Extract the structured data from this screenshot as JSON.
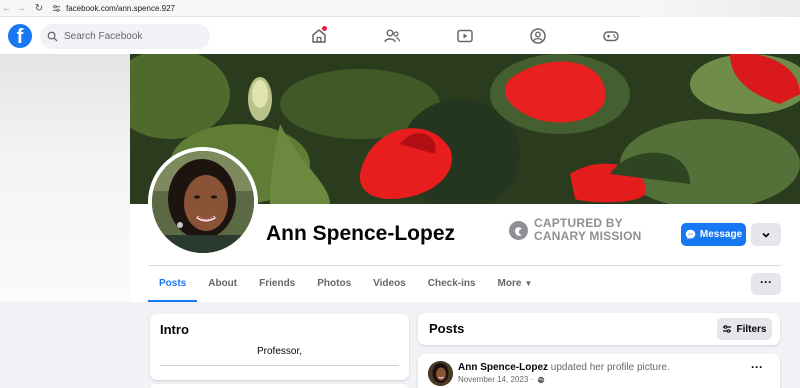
{
  "browser": {
    "url": "facebook.com/ann.spence.927",
    "back_icon": "arrow-left-icon",
    "forward_icon": "arrow-right-icon",
    "reload_icon": "reload-icon"
  },
  "nav": {
    "logo_letter": "f",
    "search_placeholder": "Search Facebook",
    "icons": [
      "home-icon",
      "friends-icon",
      "watch-icon",
      "groups-icon",
      "gaming-icon"
    ],
    "accent_color": "#1877f2",
    "notification_color": "#e41e3f"
  },
  "profile": {
    "name": "Ann Spence-Lopez",
    "stamp_line1": "CAPTURED BY",
    "stamp_line2": "CANARY MISSION",
    "message_label": "Message"
  },
  "tabs": [
    {
      "label": "Posts",
      "active": true
    },
    {
      "label": "About",
      "active": false
    },
    {
      "label": "Friends",
      "active": false
    },
    {
      "label": "Photos",
      "active": false
    },
    {
      "label": "Videos",
      "active": false
    },
    {
      "label": "Check-ins",
      "active": false
    },
    {
      "label": "More",
      "active": false
    }
  ],
  "intro": {
    "title": "Intro",
    "bio": "Professor,"
  },
  "posts": {
    "title": "Posts",
    "filters_label": "Filters",
    "items": [
      {
        "author": "Ann Spence-Lopez",
        "action": "updated her profile picture.",
        "date": "November 14, 2023 ·"
      }
    ]
  }
}
